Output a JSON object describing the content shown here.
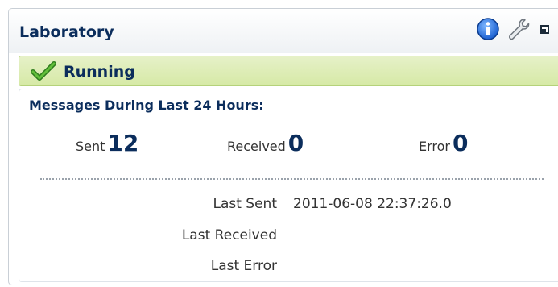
{
  "panel": {
    "title": "Laboratory",
    "icons": [
      "info-icon",
      "wrench-icon",
      "maximize-icon"
    ]
  },
  "status": {
    "icon": "check-icon",
    "text": "Running",
    "color": "#d6e9a6"
  },
  "messages": {
    "title": "Messages During Last 24 Hours:",
    "sent_label": "Sent",
    "sent_value": "12",
    "received_label": "Received",
    "received_value": "0",
    "error_label": "Error",
    "error_value": "0",
    "last_sent_label": "Last Sent",
    "last_sent_value": "2011-06-08 22:37:26.0",
    "last_received_label": "Last Received",
    "last_received_value": "",
    "last_error_label": "Last Error",
    "last_error_value": ""
  },
  "colors": {
    "title": "#0b2d5c",
    "accent": "#1f6fd6"
  }
}
